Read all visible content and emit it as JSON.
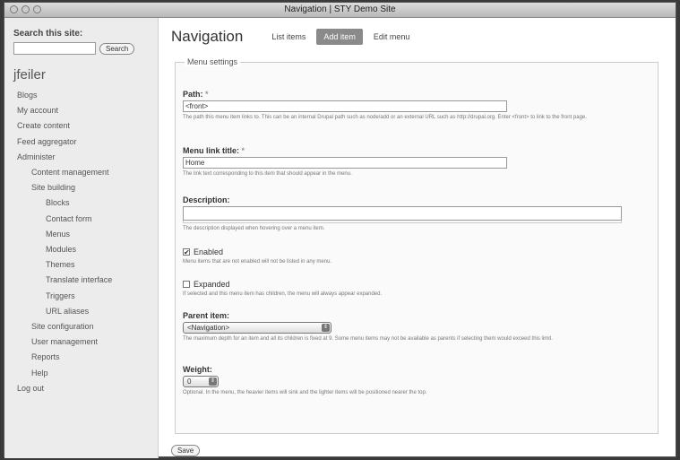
{
  "window": {
    "title": "Navigation | STY Demo Site"
  },
  "sidebar": {
    "search_label": "Search this site:",
    "search_placeholder": "",
    "search_button": "Search",
    "username": "jfeiler",
    "nav": [
      {
        "label": "Blogs",
        "level": 1
      },
      {
        "label": "My account",
        "level": 1
      },
      {
        "label": "Create content",
        "level": 1
      },
      {
        "label": "Feed aggregator",
        "level": 1
      },
      {
        "label": "Administer",
        "level": 1
      },
      {
        "label": "Content management",
        "level": 2
      },
      {
        "label": "Site building",
        "level": 2
      },
      {
        "label": "Blocks",
        "level": 3
      },
      {
        "label": "Contact form",
        "level": 3
      },
      {
        "label": "Menus",
        "level": 3
      },
      {
        "label": "Modules",
        "level": 3
      },
      {
        "label": "Themes",
        "level": 3
      },
      {
        "label": "Translate interface",
        "level": 3
      },
      {
        "label": "Triggers",
        "level": 3
      },
      {
        "label": "URL aliases",
        "level": 3
      },
      {
        "label": "Site configuration",
        "level": 2
      },
      {
        "label": "User management",
        "level": 2
      },
      {
        "label": "Reports",
        "level": 2
      },
      {
        "label": "Help",
        "level": 2
      },
      {
        "label": "Log out",
        "level": 1
      }
    ]
  },
  "header": {
    "title": "Navigation",
    "tabs": [
      {
        "label": "List items",
        "active": false
      },
      {
        "label": "Add item",
        "active": true
      },
      {
        "label": "Edit menu",
        "active": false
      }
    ]
  },
  "form": {
    "legend": "Menu settings",
    "path": {
      "label": "Path:",
      "required": "*",
      "value": "<front>",
      "description": "The path this menu item links to. This can be an internal Drupal path such as node/add or an external URL such as http://drupal.org. Enter <front> to link to the front page."
    },
    "link_title": {
      "label": "Menu link title:",
      "required": "*",
      "value": "Home",
      "description": "The link text corresponding to this item that should appear in the menu."
    },
    "description": {
      "label": "Description:",
      "value": "",
      "description": "The description displayed when hovering over a menu item."
    },
    "enabled": {
      "label": "Enabled",
      "checked": true,
      "description": "Menu items that are not enabled will not be listed in any menu."
    },
    "expanded": {
      "label": "Expanded",
      "checked": false,
      "description": "If selected and this menu item has children, the menu will always appear expanded."
    },
    "parent": {
      "label": "Parent item:",
      "value": "<Navigation>",
      "description": "The maximum depth for an item and all its children is fixed at 9. Some menu items may not be available as parents if selecting them would exceed this limit."
    },
    "weight": {
      "label": "Weight:",
      "value": "0",
      "description": "Optional. In the menu, the heavier items will sink and the lighter items will be positioned nearer the top."
    },
    "save_button": "Save"
  }
}
